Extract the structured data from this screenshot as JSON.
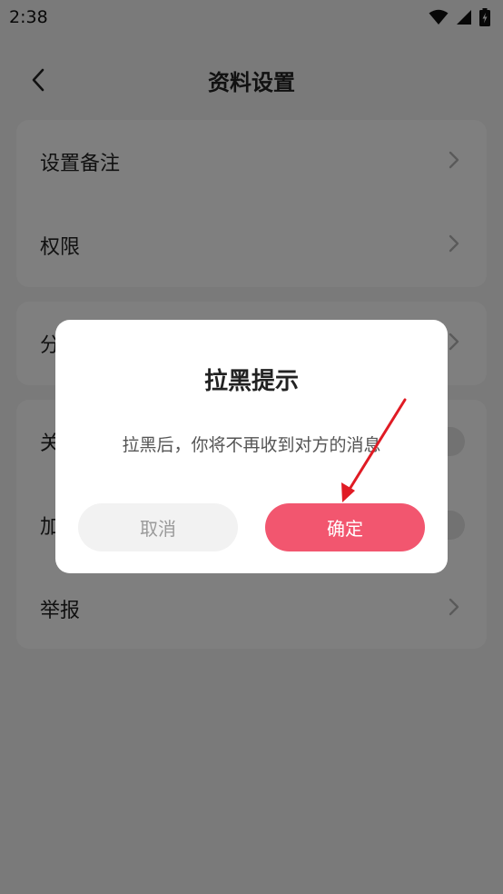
{
  "status_bar": {
    "time": "2:38"
  },
  "header": {
    "title": "资料设置",
    "back_icon": "chevron-left-icon"
  },
  "settings": {
    "card1": [
      {
        "label": "设置备注",
        "control": "chevron"
      },
      {
        "label": "权限",
        "control": "chevron"
      }
    ],
    "card2": [
      {
        "label": "分",
        "control": "chevron"
      }
    ],
    "card3": [
      {
        "label": "关",
        "control": "toggle"
      },
      {
        "label": "加",
        "control": "toggle"
      },
      {
        "label": "举报",
        "control": "chevron"
      }
    ]
  },
  "dialog": {
    "title": "拉黑提示",
    "message": "拉黑后，你将不再收到对方的消息",
    "cancel_label": "取消",
    "confirm_label": "确定"
  },
  "colors": {
    "accent": "#f2566f",
    "annotation_arrow": "#e01b24"
  }
}
